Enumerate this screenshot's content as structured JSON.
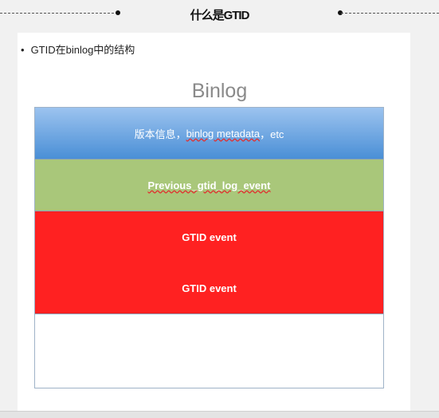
{
  "header": {
    "title": "什么是GTID"
  },
  "bullet": "GTID在binlog中的结构",
  "diagram": {
    "title": "Binlog",
    "rows": [
      {
        "label_prefix": "版本信息，",
        "label_main": "binlog metadata",
        "label_suffix": "，etc",
        "color": "#5b9bd5"
      },
      {
        "label_main": "Previous_gtid_log_event",
        "color": "#a9c77a"
      },
      {
        "label": "GTID event",
        "color": "#ff2121"
      },
      {
        "label": "GTID event",
        "color": "#ff2121"
      }
    ]
  }
}
